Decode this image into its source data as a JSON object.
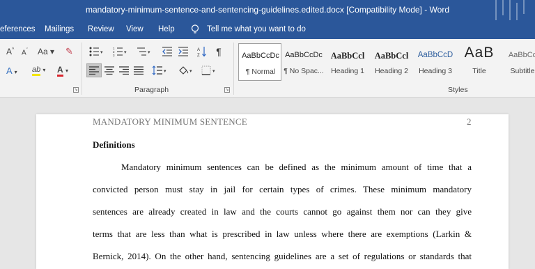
{
  "window": {
    "title": "mandatory-minimum-sentence-and-sentencing-guidelines.edited.docx [Compatibility Mode]  -  Word"
  },
  "menu": {
    "items": [
      "eferences",
      "Mailings",
      "Review",
      "View",
      "Help"
    ],
    "tell_me": "Tell me what you want to do"
  },
  "ribbon": {
    "font_group": {
      "grow_font": "A",
      "shrink_font": "A",
      "change_case": "Aa",
      "text_effects": "A",
      "highlight": "ab",
      "font_color": "A"
    },
    "paragraph_group": {
      "label": "Paragraph"
    },
    "styles_group": {
      "label": "Styles",
      "styles": [
        {
          "sample": "AaBbCcDc",
          "name": "¶ Normal"
        },
        {
          "sample": "AaBbCcDc",
          "name": "¶ No Spac..."
        },
        {
          "sample": "AaBbCcl",
          "name": "Heading 1"
        },
        {
          "sample": "AaBbCcl",
          "name": "Heading 2"
        },
        {
          "sample": "AaBbCcD",
          "name": "Heading 3"
        },
        {
          "sample": "AaB",
          "name": "Title"
        },
        {
          "sample": "AaBbCc",
          "name": "Subtitle"
        }
      ]
    }
  },
  "document": {
    "running_header": "MANDATORY MINIMUM SENTENCE",
    "page_number": "2",
    "heading": "Definitions",
    "lines": [
      "Mandatory minimum sentences can be defined as the minimum amount of time that a",
      "convicted person must stay in jail for certain types of crimes. These minimum mandatory",
      "sentences are already created in law and the courts cannot go against them nor can they give",
      "terms that are less than what is prescribed in law unless where there are exemptions (Larkin &",
      "Bernick, 2014). On the other hand, sentencing guidelines are a set of regulations or standards that"
    ]
  }
}
